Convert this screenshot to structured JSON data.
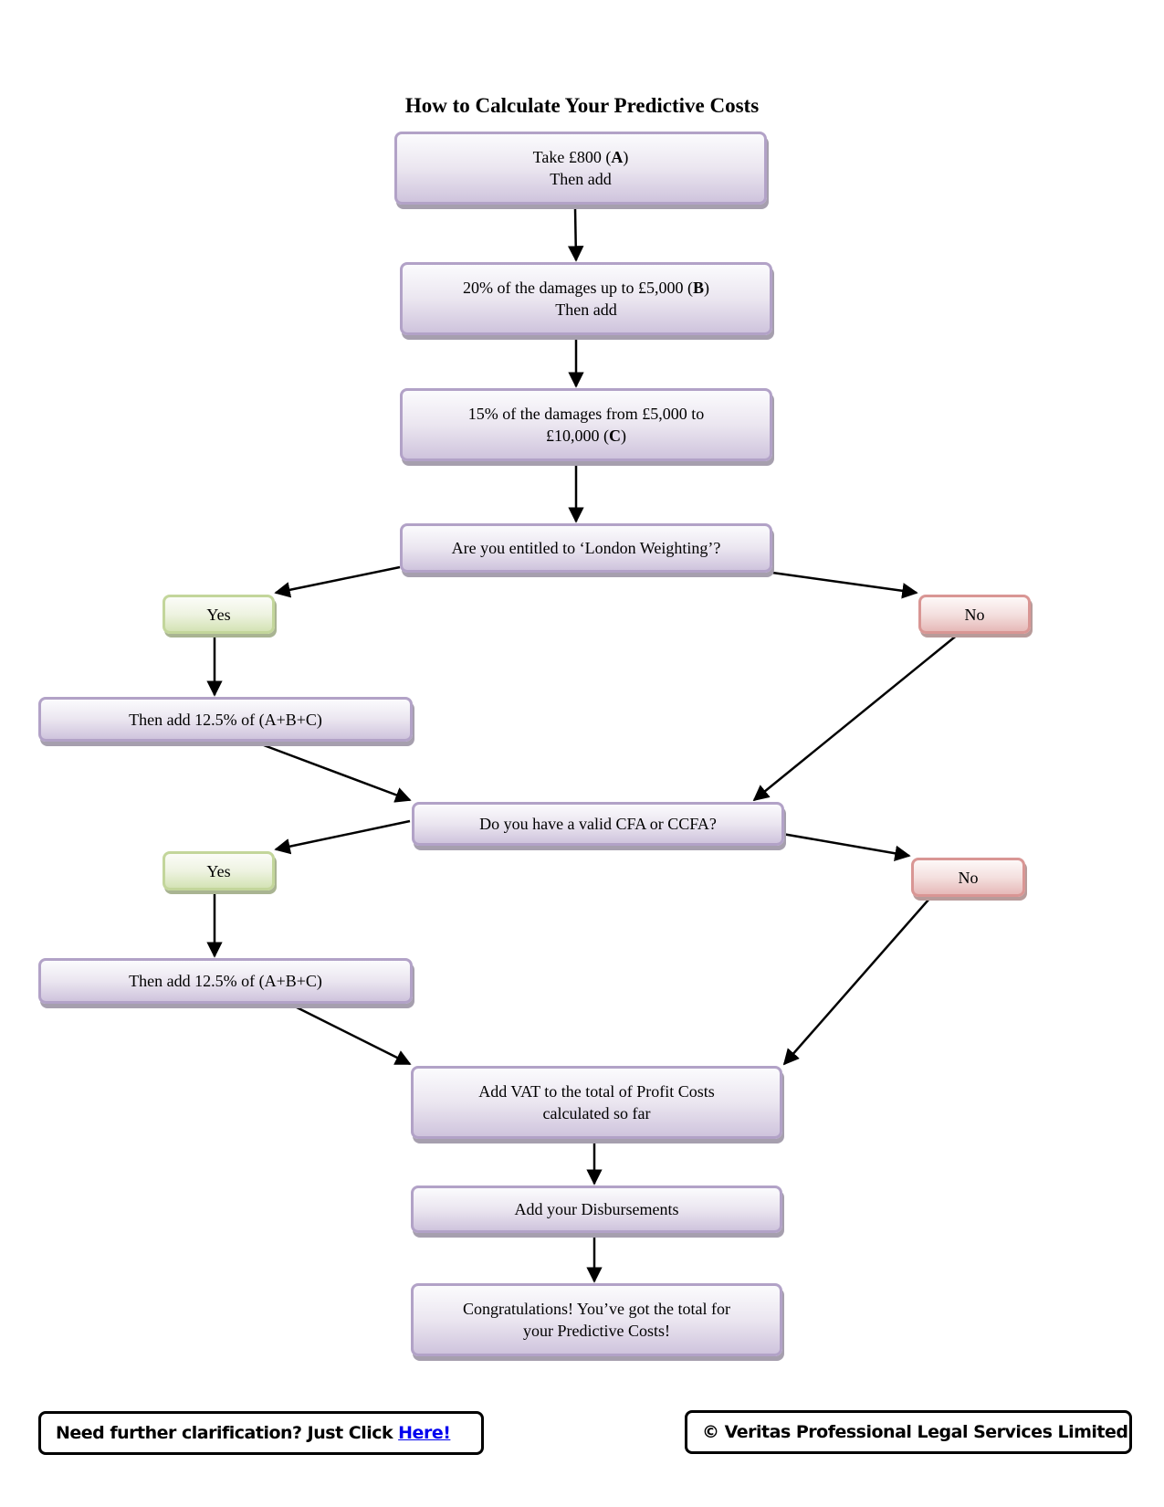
{
  "title": "How to Calculate Your Predictive Costs",
  "nodes": {
    "start": {
      "line1_pre": "Take £800 (",
      "line1_bold": "A",
      "line1_post": ")",
      "line2": "Then add"
    },
    "step_b": {
      "line1_pre": "20% of the damages up to £5,000 (",
      "line1_bold": "B",
      "line1_post": ")",
      "line2": "Then add"
    },
    "step_c": {
      "line1": "15% of the damages from £5,000 to",
      "line2_pre": "£10,000 (",
      "line2_bold": "C",
      "line2_post": ")"
    },
    "q_london": {
      "label": "Are you entitled to ‘London Weighting’?"
    },
    "london_yes": {
      "label": "Yes"
    },
    "london_no": {
      "label": "No"
    },
    "london_add": {
      "label": "Then add 12.5% of (A+B+C)"
    },
    "q_cfa": {
      "label": "Do you have a valid CFA or CCFA?"
    },
    "cfa_yes": {
      "label": "Yes"
    },
    "cfa_no": {
      "label": "No"
    },
    "cfa_add": {
      "label": "Then add 12.5% of (A+B+C)"
    },
    "vat": {
      "line1": "Add VAT to the total of Profit Costs",
      "line2": "calculated so far"
    },
    "disbursements": {
      "label": "Add your Disbursements"
    },
    "done": {
      "line1": "Congratulations! You’ve got the total for",
      "line2": "your Predictive Costs!"
    }
  },
  "footer": {
    "help_text": "Need further clarification? Just Click",
    "help_link": "Here!",
    "copyright": "© Veritas Professional Legal Services Limited"
  }
}
